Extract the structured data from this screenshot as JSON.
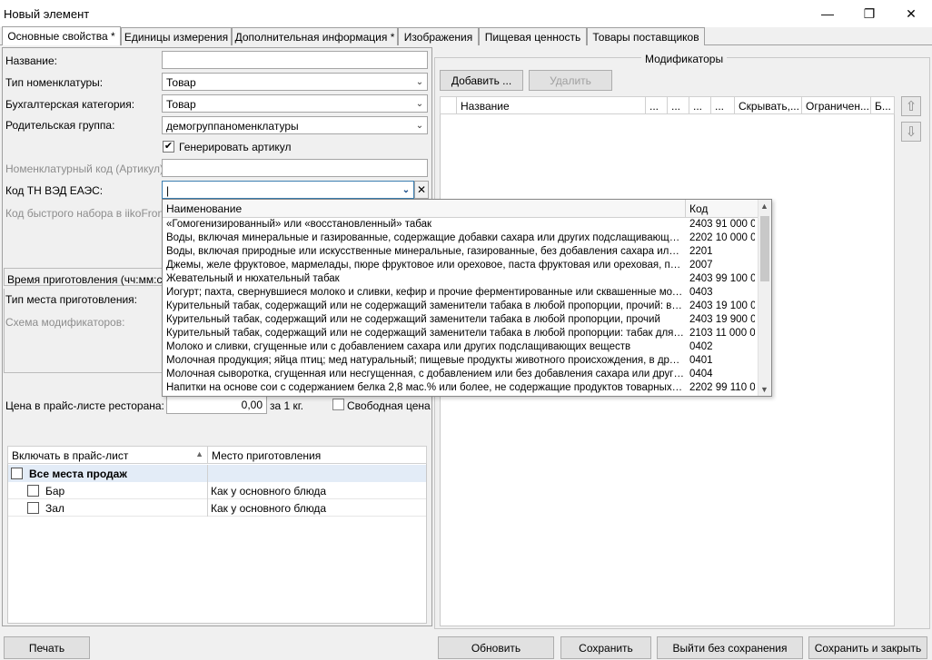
{
  "window": {
    "title": "Новый элемент",
    "minimize_glyph": "—",
    "maximize_glyph": "❐",
    "close_glyph": "✕"
  },
  "tabs": [
    {
      "label": "Основные свойства *",
      "active": true
    },
    {
      "label": "Единицы измерения"
    },
    {
      "label": "Дополнительная информация *"
    },
    {
      "label": "Изображения"
    },
    {
      "label": "Пищевая ценность"
    },
    {
      "label": "Товары поставщиков"
    }
  ],
  "form": {
    "name_label": "Название:",
    "name_value": "",
    "type_label": "Тип номенклатуры:",
    "type_value": "Товар",
    "accounting_label": "Бухгалтерская категория:",
    "accounting_value": "Товар",
    "parent_label": "Родительская группа:",
    "parent_value": "демогруппаноменклатуры",
    "generate_label": "Генерировать артикул",
    "generate_checked": "✔",
    "article_label": "Номенклатурный код (Артикул):",
    "article_value": "",
    "tnved_label": "Код ТН ВЭД ЕАЭС:",
    "tnved_value": "|",
    "quick_label": "Код быстрого набора в iikoFront:",
    "cook_time_label": "Время приготовления (чч:мм:сс):",
    "place_type_label": "Тип места приготовления:",
    "modifier_scheme_label": "Схема модификаторов:",
    "price_label": "Цена в прайс-листе ресторана:",
    "price_value": "0,00",
    "price_unit": "за 1 кг.",
    "free_price_label": "Свободная цена"
  },
  "pricelist": {
    "col_include": "Включать в прайс-лист",
    "col_place": "Место приготовления",
    "rows": [
      {
        "name": "Все места продаж",
        "place": "",
        "bold": true
      },
      {
        "name": "Бар",
        "place": "Как у основного блюда"
      },
      {
        "name": "Зал",
        "place": "Как у основного блюда"
      }
    ]
  },
  "modifiers": {
    "group_title": "Модификаторы",
    "add_label": "Добавить ...",
    "delete_label": "Удалить",
    "columns": [
      "Название",
      "...",
      "...",
      "...",
      "...",
      "Скрывать,...",
      "Ограничен...",
      "Б..."
    ],
    "up_icon": "⇧",
    "down_icon": "⇩"
  },
  "popup": {
    "col_name": "Наименование",
    "col_code": "Код",
    "rows": [
      {
        "name": "«Гомогенизированный» или «восстановленный» табак",
        "code": "2403 91 000 0"
      },
      {
        "name": "Воды, включая минеральные и газированные, содержащие добавки сахара или других подслащивающих и...",
        "code": "2202 10 000 0"
      },
      {
        "name": "Воды, включая природные или искусственные минеральные, газированные, без добавления сахара или др...",
        "code": "2201"
      },
      {
        "name": "Джемы, желе фруктовое, мармелады, пюре фруктовое или ореховое, паста фруктовая или ореховая, полу...",
        "code": "2007"
      },
      {
        "name": "Жевательный и нюхательный табак",
        "code": "2403 99 100 0"
      },
      {
        "name": "Йогурт; пахта, свернувшиеся молоко и сливки, кефир и прочие ферментированные или сквашенные молоко...",
        "code": "0403"
      },
      {
        "name": "Курительный табак, содержащий или не содержащий заменители табака в любой пропорции, прочий: в пе...",
        "code": "2403 19 100 0"
      },
      {
        "name": "Курительный табак, содержащий или не содержащий заменители табака в любой пропорции, прочий",
        "code": "2403 19 900 0"
      },
      {
        "name": "Курительный табак, содержащий или не содержащий заменители табака в любой пропорции: табак для ка...",
        "code": "2103 11 000 0"
      },
      {
        "name": "Молоко и сливки, сгущенные или с добавлением сахара или других подслащивающих веществ",
        "code": "0402"
      },
      {
        "name": "Молочная продукция; яйца птиц; мед натуральный; пищевые продукты животного происхождения, в друг...",
        "code": "0401"
      },
      {
        "name": "Молочная сыворотка, сгущенная или несгущенная, с добавлением или без добавления сахара или других п...",
        "code": "0404"
      },
      {
        "name": "Напитки на основе сои с содержанием белка 2,8 мас.% или более, не содержащие продуктов товарных поз...",
        "code": "2202 99 110 0"
      }
    ]
  },
  "buttons": {
    "print": "Печать",
    "refresh": "Обновить",
    "save": "Сохранить",
    "exit_no_save": "Выйти без сохранения",
    "save_close": "Сохранить и закрыть"
  }
}
